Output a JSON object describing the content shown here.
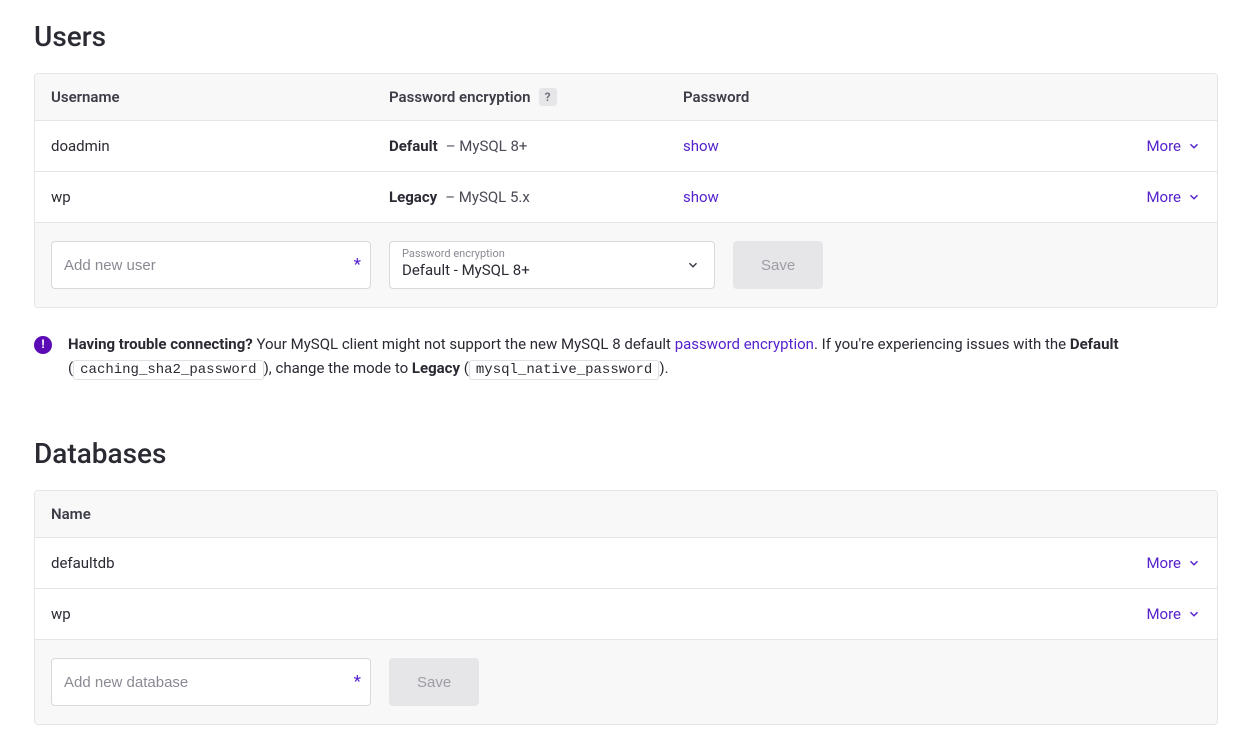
{
  "users": {
    "title": "Users",
    "headers": {
      "username": "Username",
      "encryption": "Password encryption",
      "password": "Password"
    },
    "help_symbol": "?",
    "rows": [
      {
        "username": "doadmin",
        "enc_bold": "Default",
        "enc_rest": " – MySQL 8+",
        "password_action": "show",
        "more_label": "More"
      },
      {
        "username": "wp",
        "enc_bold": "Legacy",
        "enc_rest": " – MySQL 5.x",
        "password_action": "show",
        "more_label": "More"
      }
    ],
    "add": {
      "placeholder": "Add new user",
      "required_mark": "*",
      "enc_label": "Password encryption",
      "enc_value": "Default - MySQL 8+",
      "save_label": "Save"
    }
  },
  "notice": {
    "lead": "Having trouble connecting?",
    "part1": " Your MySQL client might not support the new MySQL 8 default ",
    "link": "password encryption",
    "part2": ". If you're experiencing issues with the ",
    "default_label": "Default",
    "open_paren": " (",
    "code1": "caching_sha2_password",
    "mid": "), change the mode to ",
    "legacy_label": "Legacy",
    "code2": "mysql_native_password",
    "close": ")."
  },
  "databases": {
    "title": "Databases",
    "headers": {
      "name": "Name"
    },
    "rows": [
      {
        "name": "defaultdb",
        "more_label": "More"
      },
      {
        "name": "wp",
        "more_label": "More"
      }
    ],
    "add": {
      "placeholder": "Add new database",
      "required_mark": "*",
      "save_label": "Save"
    }
  }
}
